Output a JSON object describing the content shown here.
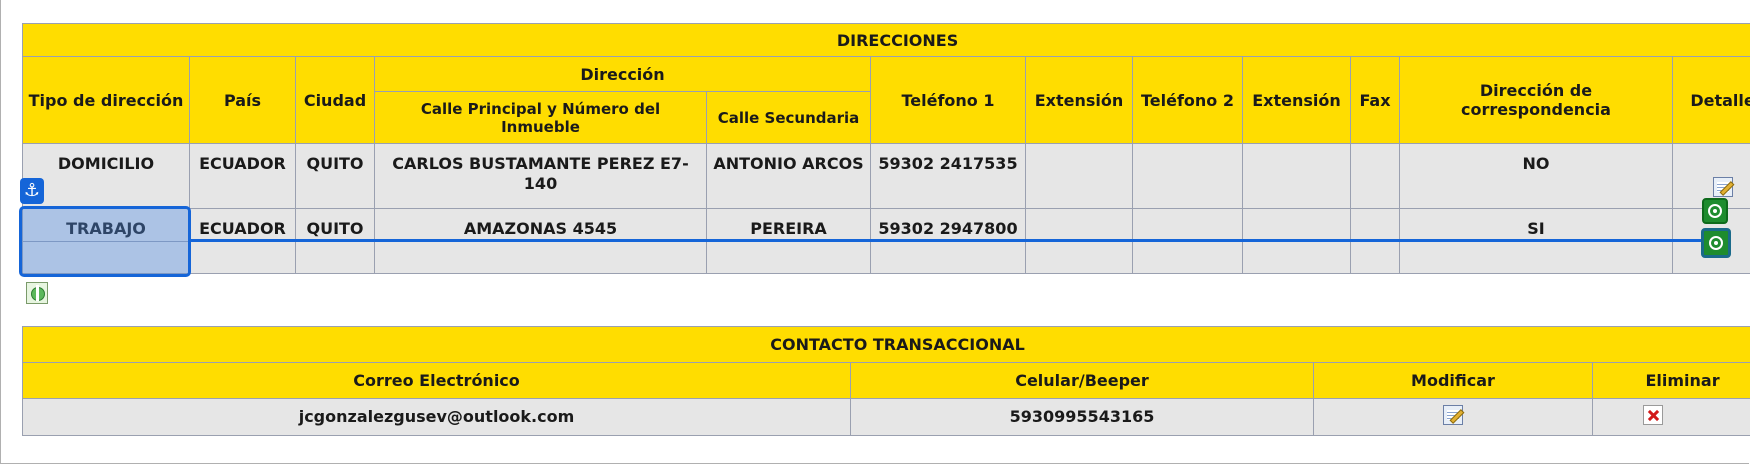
{
  "direcciones": {
    "title": "DIRECCIONES",
    "headers": {
      "tipo": "Tipo de dirección",
      "pais": "País",
      "ciudad": "Ciudad",
      "direccion": "Dirección",
      "calle_principal": "Calle Principal y Número del Inmueble",
      "calle_secundaria": "Calle Secundaria",
      "telefono1": "Teléfono 1",
      "extension1": "Extensión",
      "telefono2": "Teléfono 2",
      "extension2": "Extensión",
      "fax": "Fax",
      "correspondencia": "Dirección de correspondencia",
      "detalle": "Detalle"
    },
    "rows": [
      {
        "tipo": "DOMICILIO",
        "pais": "ECUADOR",
        "ciudad": "QUITO",
        "calle_principal": "CARLOS BUSTAMANTE PEREZ E7-140",
        "calle_secundaria": "ANTONIO ARCOS",
        "telefono1": "59302 2417535",
        "extension1": "",
        "telefono2": "",
        "extension2": "",
        "fax": "",
        "correspondencia": "NO"
      },
      {
        "tipo": "TRABAJO",
        "pais": "ECUADOR",
        "ciudad": "QUITO",
        "calle_principal": "AMAZONAS 4545",
        "calle_secundaria": "PEREIRA",
        "telefono1": "59302 2947800",
        "extension1": "",
        "telefono2": "",
        "extension2": "",
        "fax": "",
        "correspondencia": "SI"
      }
    ]
  },
  "contacto": {
    "title": "CONTACTO TRANSACCIONAL",
    "headers": {
      "correo": "Correo Electrónico",
      "celular": "Celular/Beeper",
      "modificar": "Modificar",
      "eliminar": "Eliminar"
    },
    "row": {
      "correo": "jcgonzalezgusev@outlook.com",
      "celular": "5930995543165"
    }
  },
  "icons": {
    "edit": "edit-icon",
    "delete": "delete-icon",
    "add": "add-address-icon",
    "anchor": "anchor-icon",
    "target": "target-icon"
  },
  "colors": {
    "header_bg": "#ffdd00",
    "row_bg": "#e6e6e6",
    "selection": "#1565d8",
    "target": "#1e8c2e"
  },
  "overlay": {
    "anchor_glyph": "⚓"
  }
}
